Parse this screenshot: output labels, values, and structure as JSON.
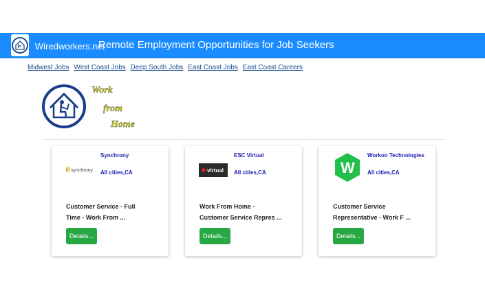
{
  "header": {
    "brand": "Wiredworkers.net",
    "tagline": "Remote Employment Opportunities for Job Seekers",
    "bg_color": "#1a8cff"
  },
  "nav": {
    "links": [
      "Midwest Jobs",
      "West Coast Jobs",
      "Deep South Jobs",
      "East Coast Jobs",
      "East Coast Careers"
    ]
  },
  "hero": {
    "line1": "Work",
    "line2": "from",
    "line3": "Home",
    "icon": "house-with-worker-icon"
  },
  "jobs": [
    {
      "company": "Synchrony",
      "logo_text": "synchrony",
      "location": "All cities,CA",
      "title_line1": "Customer Service - Full",
      "title_line2": "Time - Work From ...",
      "button": "Details..."
    },
    {
      "company": "ESC Virtual",
      "logo_text": "virtual",
      "location": "All cities,CA",
      "title_line1": "Work From Home -",
      "title_line2": "Customer Service Repres ...",
      "button": "Details..."
    },
    {
      "company": "Workoo Technologies",
      "logo_text": "W",
      "location": "All cities,CA",
      "title_line1": "Customer Service",
      "title_line2": "Representative - Work F ...",
      "button": "Details..."
    }
  ],
  "colors": {
    "button": "#28a745",
    "company_text": "#1a1ab0",
    "hero_text": "#c8c800"
  }
}
